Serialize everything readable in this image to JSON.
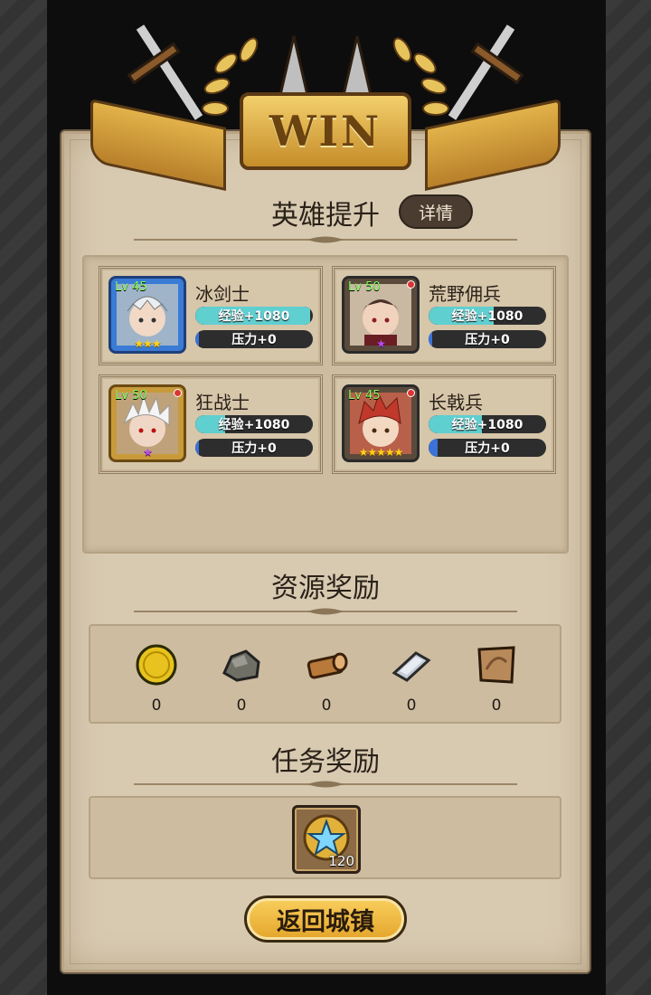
{
  "banner": {
    "title": "WIN"
  },
  "hero_section": {
    "title": "英雄提升",
    "details_label": "详情",
    "heroes": [
      {
        "name": "冰剑士",
        "level": "Lv 45",
        "exp": "经验+1080",
        "pressure": "压力+0",
        "exp_progress": 0.98,
        "pressure_progress": 0.03,
        "stars": "★★★",
        "star_color": "gold",
        "frame": "blue"
      },
      {
        "name": "荒野佣兵",
        "level": "Lv 50",
        "exp": "经验+1080",
        "pressure": "压力+0",
        "exp_progress": 0.55,
        "pressure_progress": 0.03,
        "stars": "★",
        "star_color": "purple",
        "frame": "dark"
      },
      {
        "name": "狂战士",
        "level": "Lv 50",
        "exp": "经验+1080",
        "pressure": "压力+0",
        "exp_progress": 0.25,
        "pressure_progress": 0.03,
        "stars": "★",
        "star_color": "purple",
        "frame": "gold"
      },
      {
        "name": "长戟兵",
        "level": "Lv 45",
        "exp": "经验+1080",
        "pressure": "压力+0",
        "exp_progress": 0.45,
        "pressure_progress": 0.08,
        "stars": "★★★★★",
        "star_color": "gold",
        "frame": "dark"
      }
    ]
  },
  "resource_section": {
    "title": "资源奖励",
    "items": [
      {
        "icon": "gold-coin-icon",
        "count": "0"
      },
      {
        "icon": "stone-ore-icon",
        "count": "0"
      },
      {
        "icon": "wood-log-icon",
        "count": "0"
      },
      {
        "icon": "iron-ingot-icon",
        "count": "0"
      },
      {
        "icon": "leather-hide-icon",
        "count": "0"
      }
    ]
  },
  "task_section": {
    "title": "任务奖励",
    "item": {
      "icon": "star-medal-icon",
      "count": "120"
    }
  },
  "return_button": {
    "label": "返回城镇"
  }
}
